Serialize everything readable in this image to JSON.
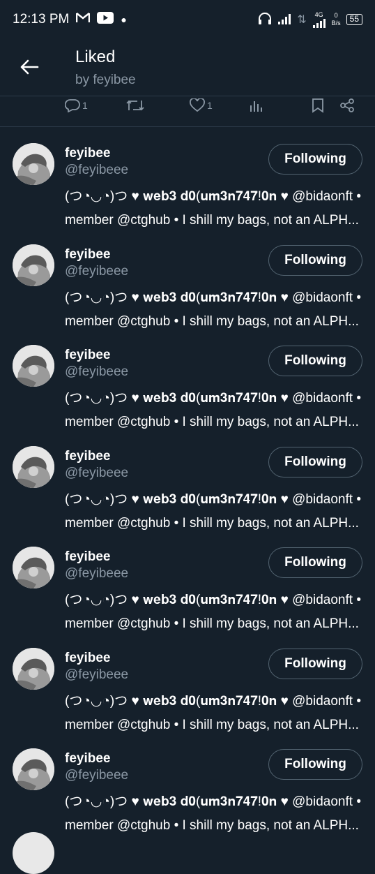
{
  "status_bar": {
    "time": "12:13 PM",
    "network": "4G",
    "speed": "0",
    "speed_unit": "B/s",
    "battery": "55"
  },
  "header": {
    "title": "Liked",
    "subtitle": "by feyibee"
  },
  "tweet_actions": {
    "reply_count": "1",
    "like_count": "1"
  },
  "users": [
    {
      "name": "feyibee",
      "handle": "@feyibeee",
      "button": "Following",
      "bio_line1": "(つ◔◡◔)つ ♥ 𝐰𝐞𝐛𝟑 𝐝𝟎(𝐮𝐦𝟑𝐧𝟕𝟒𝟕!𝟎𝐧 ♥ @bidaonft •",
      "bio_line2": "member @ctghub • I shill my bags, not an ALPH..."
    },
    {
      "name": "feyibee",
      "handle": "@feyibeee",
      "button": "Following",
      "bio_line1": "(つ◔◡◔)つ ♥ 𝐰𝐞𝐛𝟑 𝐝𝟎(𝐮𝐦𝟑𝐧𝟕𝟒𝟕!𝟎𝐧 ♥ @bidaonft •",
      "bio_line2": "member @ctghub • I shill my bags, not an ALPH..."
    },
    {
      "name": "feyibee",
      "handle": "@feyibeee",
      "button": "Following",
      "bio_line1": "(つ◔◡◔)つ ♥ 𝐰𝐞𝐛𝟑 𝐝𝟎(𝐮𝐦𝟑𝐧𝟕𝟒𝟕!𝟎𝐧 ♥ @bidaonft •",
      "bio_line2": "member @ctghub • I shill my bags, not an ALPH..."
    },
    {
      "name": "feyibee",
      "handle": "@feyibeee",
      "button": "Following",
      "bio_line1": "(つ◔◡◔)つ ♥ 𝐰𝐞𝐛𝟑 𝐝𝟎(𝐮𝐦𝟑𝐧𝟕𝟒𝟕!𝟎𝐧 ♥ @bidaonft •",
      "bio_line2": "member @ctghub • I shill my bags, not an ALPH..."
    },
    {
      "name": "feyibee",
      "handle": "@feyibeee",
      "button": "Following",
      "bio_line1": "(つ◔◡◔)つ ♥ 𝐰𝐞𝐛𝟑 𝐝𝟎(𝐮𝐦𝟑𝐧𝟕𝟒𝟕!𝟎𝐧 ♥ @bidaonft •",
      "bio_line2": "member @ctghub • I shill my bags, not an ALPH..."
    },
    {
      "name": "feyibee",
      "handle": "@feyibeee",
      "button": "Following",
      "bio_line1": "(つ◔◡◔)つ ♥ 𝐰𝐞𝐛𝟑 𝐝𝟎(𝐮𝐦𝟑𝐧𝟕𝟒𝟕!𝟎𝐧 ♥ @bidaonft •",
      "bio_line2": "member @ctghub • I shill my bags, not an ALPH..."
    },
    {
      "name": "feyibee",
      "handle": "@feyibeee",
      "button": "Following",
      "bio_line1": "(つ◔◡◔)つ ♥ 𝐰𝐞𝐛𝟑 𝐝𝟎(𝐮𝐦𝟑𝐧𝟕𝟒𝟕!𝟎𝐧 ♥ @bidaonft •",
      "bio_line2": "member @ctghub • I shill my bags, not an ALPH..."
    }
  ],
  "colors": {
    "background": "#15202b",
    "secondary_text": "#8b98a5",
    "divider": "#2b3a48",
    "button_border": "#536471"
  }
}
